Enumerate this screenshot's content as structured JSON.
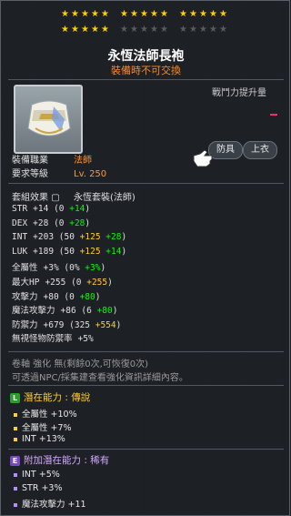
{
  "stars": {
    "row1_groups": [
      5,
      5,
      5
    ],
    "row1_filled": 15,
    "row2_groups": [
      5,
      5,
      5
    ],
    "row2_filled": 5
  },
  "item": {
    "name": "永恆法師長袍",
    "tradeability": "裝備時不可交換",
    "power_label": "戰鬥力提升量"
  },
  "buttons": {
    "equip": "防具",
    "type": "上衣"
  },
  "requirements": [
    {
      "label": "裝備職業",
      "value": "法師"
    },
    {
      "label": "要求等級",
      "value": "Lv. 250"
    }
  ],
  "set": {
    "label": "套組效果",
    "value": "永恆套裝(法師)"
  },
  "stats": [
    {
      "name": "STR",
      "base": "+14",
      "breakdown": [
        "(0 ",
        "+14",
        ")"
      ]
    },
    {
      "name": "DEX",
      "base": "+28",
      "breakdown": [
        "(0 ",
        "+28",
        ")"
      ]
    },
    {
      "name": "INT",
      "base": "+203",
      "breakdown": [
        "(50 ",
        "+125",
        " ",
        "+28",
        ")"
      ]
    },
    {
      "name": "LUK",
      "base": "+189",
      "breakdown": [
        "(50 ",
        "+125",
        " ",
        "+14",
        ")"
      ]
    },
    {
      "name": "全屬性",
      "base": "+3%",
      "breakdown": [
        "(0% ",
        "+3%",
        ")"
      ]
    },
    {
      "name": "最大HP",
      "base": "+255",
      "breakdown": [
        "(0 ",
        "+255",
        ")"
      ]
    },
    {
      "name": "攻擊力",
      "base": "+80",
      "breakdown": [
        "(0 ",
        "+80",
        ")"
      ]
    },
    {
      "name": "魔法攻擊力",
      "base": "+86",
      "breakdown": [
        "(6 ",
        "+80",
        ")"
      ]
    },
    {
      "name": "防禦力",
      "base": "+679",
      "breakdown": [
        "(325 ",
        "+554",
        ")"
      ]
    },
    {
      "name": "無視怪物防禦率",
      "base": "+5%",
      "breakdown": []
    }
  ],
  "notes": {
    "scroll": "卷軸 強化 無(剩餘0次,可恢復0次)",
    "npc": "可透過NPC/採集建查看強化資訊詳細內容。"
  },
  "potential": {
    "header_label": "潛在能力",
    "header_grade": "傳說",
    "badge": "L",
    "lines": [
      "全屬性 +10%",
      "全屬性 +7%",
      "INT +13%"
    ]
  },
  "bonus_potential": {
    "header_label": "附加潛在能力",
    "header_grade": "稀有",
    "badge": "E",
    "lines": [
      "INT +5%",
      "STR +3%",
      "魔法攻擊力 +11"
    ]
  },
  "colors": {
    "stars_on": "#ffcc00",
    "untradeable": "#ff8822",
    "green_bonus": "#00ff00",
    "yellow_bonus": "#ffcc33"
  }
}
